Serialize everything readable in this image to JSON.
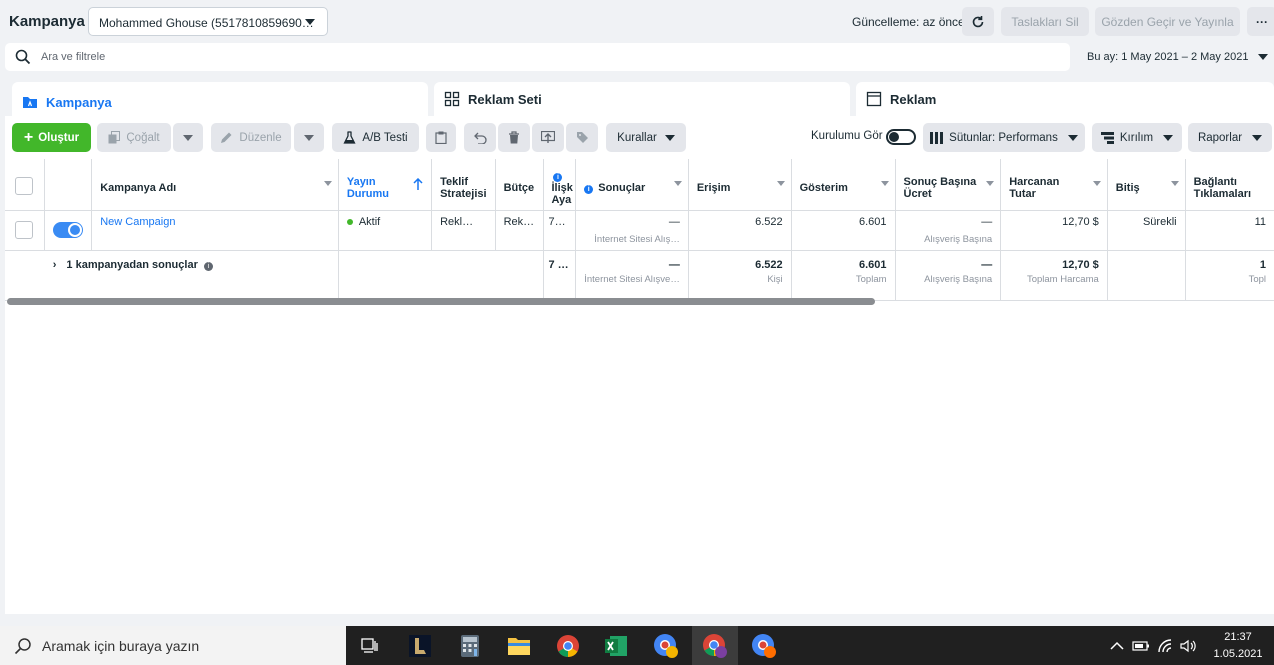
{
  "header": {
    "title": "Kampanya",
    "account": "Mohammed Ghouse (5517810859690…",
    "update_status": "Güncelleme: az önce",
    "discard_drafts": "Taslakları Sil",
    "review_publish": "Gözden Geçir ve Yayınla",
    "more": "···"
  },
  "search": {
    "placeholder": "Ara ve filtrele"
  },
  "date_range": "Bu ay: 1 May 2021 – 2 May 2021",
  "tabs": {
    "campaign": "Kampanya",
    "adset": "Reklam Seti",
    "ad": "Reklam"
  },
  "toolbar": {
    "create": "Oluştur",
    "duplicate": "Çoğalt",
    "edit": "Düzenle",
    "ab_test": "A/B Testi",
    "rules": "Kurallar",
    "show_setup": "Kurulumu Gör",
    "columns": "Sütunlar: Performans",
    "breakdown": "Kırılım",
    "reports": "Raporlar"
  },
  "table": {
    "headers": {
      "name": "Kampanya Adı",
      "delivery_1": "Yayın",
      "delivery_2": "Durumu",
      "bid_1": "Teklif",
      "bid_2": "Stratejisi",
      "budget": "Bütçe",
      "attr_1": "İlişk",
      "attr_2": "Aya",
      "results": "Sonuçlar",
      "reach": "Erişim",
      "impressions": "Gösterim",
      "cpr_1": "Sonuç Başına",
      "cpr_2": "Ücret",
      "spent_1": "Harcanan",
      "spent_2": "Tutar",
      "ends": "Bitiş",
      "clicks_1": "Bağlantı",
      "clicks_2": "Tıklamaları"
    },
    "row": {
      "name": "New Campaign",
      "delivery": "Aktif",
      "bid": "Rekl…",
      "budget": "Rek…",
      "attr": "7…",
      "results": "—",
      "results_sub": "İnternet Sitesi Alış…",
      "reach": "6.522",
      "impressions": "6.601",
      "cpr": "—",
      "cpr_sub": "Alışveriş Başına",
      "spent": "12,70 $",
      "ends": "Sürekli",
      "clicks": "11"
    },
    "summary": {
      "label": "1 kampanyadan sonuçlar",
      "attr": "7 …",
      "results": "—",
      "results_sub": "İnternet Sitesi Alışve…",
      "reach": "6.522",
      "reach_sub": "Kişi",
      "impressions": "6.601",
      "impressions_sub": "Toplam",
      "cpr": "—",
      "cpr_sub": "Alışveriş Başına",
      "spent": "12,70 $",
      "spent_sub": "Toplam Harcama",
      "clicks": "1",
      "clicks_sub": "Topl"
    }
  },
  "taskbar": {
    "search_placeholder": "Aramak için buraya yazın",
    "time": "21:37",
    "date": "1.05.2021"
  },
  "colors": {
    "accent": "#1877f2",
    "create": "#42b72a",
    "active": "#42b72a"
  }
}
